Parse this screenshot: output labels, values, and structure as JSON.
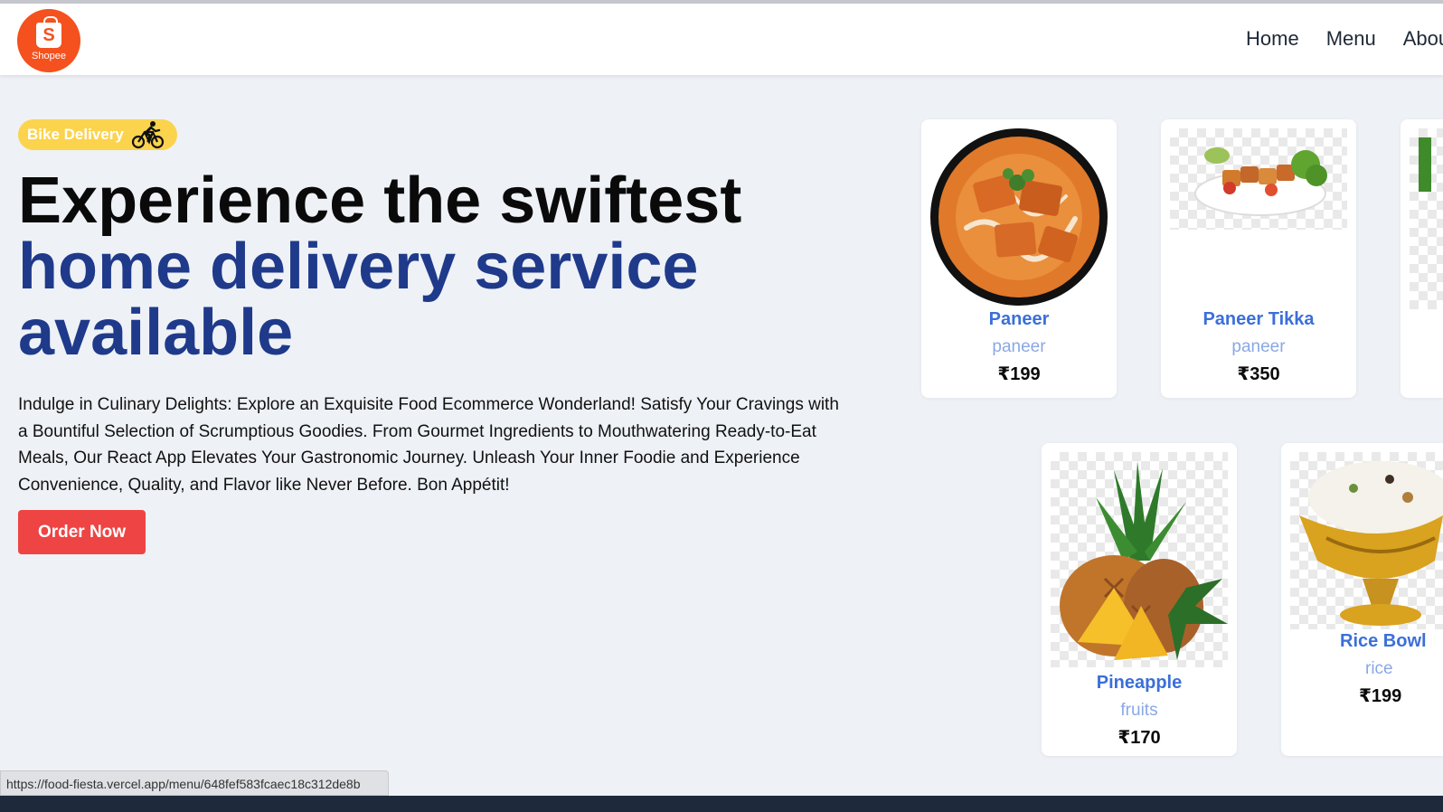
{
  "brand": {
    "logo_text": "Shopee",
    "logo_letter": "S"
  },
  "nav": {
    "items": [
      "Home",
      "Menu",
      "About Us"
    ]
  },
  "hero": {
    "badge_label": "Bike Delivery",
    "title_line1": "Experience the swiftest",
    "title_line2": "home delivery service",
    "title_line3": "available",
    "description": "Indulge in Culinary Delights: Explore an Exquisite Food Ecommerce Wonderland! Satisfy Your Cravings with a Bountiful Selection of Scrumptious Goodies. From Gourmet Ingredients to Mouthwatering Ready-to-Eat Meals, Our React App Elevates Your Gastronomic Journey. Unleash Your Inner Foodie and Experience Convenience, Quality, and Flavor like Never Before. Bon Appétit!",
    "cta_label": "Order Now"
  },
  "products": [
    {
      "name": "Paneer",
      "category": "paneer",
      "price": "₹199",
      "icon": "paneer-curry-image"
    },
    {
      "name": "Paneer Tikka",
      "category": "paneer",
      "price": "₹350",
      "icon": "paneer-tikka-image"
    },
    {
      "name": "Pineapple",
      "category": "fruits",
      "price": "₹170",
      "icon": "pineapple-image"
    },
    {
      "name": "Rice Bowl",
      "category": "rice",
      "price": "₹199",
      "icon": "rice-bowl-image"
    }
  ],
  "status_bar": {
    "url": "https://food-fiesta.vercel.app/menu/648fef583fcaec18c312de8b"
  },
  "colors": {
    "accent_red": "#ef4444",
    "title_blue": "#1f3a8a",
    "badge_yellow": "#fcd34d",
    "card_name_blue": "#3b6fd9",
    "logo_orange": "#f4511e"
  }
}
